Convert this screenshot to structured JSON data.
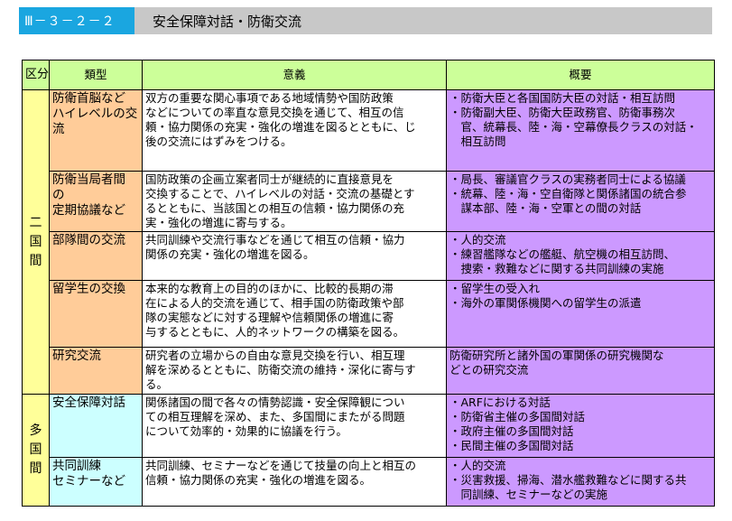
{
  "title": {
    "code": "Ⅲ－３－２－２",
    "text": "安全保障対話・防衛交流"
  },
  "table": {
    "headers": {
      "kubun": "区分",
      "ruikei": "類型",
      "igi": "意義",
      "gaiyo": "概要"
    },
    "groups": [
      {
        "kubun": "二国間",
        "rows": [
          {
            "ruikei": [
              "防衛首脳など",
              "ハイレベルの交",
              "流"
            ],
            "igi": [
              "双方の重要な関心事項である地域情勢や国防政策",
              "などについての率直な意見交換を通じて、相互の信",
              "頼・協力関係の充実・強化の増進を図るとともに、じ",
              "後の交流にはずみをつける。"
            ],
            "gaiyo": [
              "・防衛大臣と各国国防大臣の対話・相互訪問",
              "・防衛副大臣、防衛大臣政務官、防衛事務次",
              "　官、統幕長、陸・海・空幕僚長クラスの対話・",
              "　相互訪問"
            ]
          },
          {
            "ruikei": [
              "防衛当局者間",
              "の",
              "定期協議など"
            ],
            "igi": [
              "国防政策の企画立案者同士が継続的に直接意見を",
              "交換することで、ハイレベルの対話・交流の基礎とす",
              "るとともに、当該国との相互の信頼・協力関係の充",
              "実・強化の増進に寄与する。"
            ],
            "gaiyo": [
              "・局長、審議官クラスの実務者同士による協議",
              "・統幕、陸・海・空自衛隊と関係諸国の統合参",
              "　謀本部、陸・海・空軍との間の対話"
            ]
          },
          {
            "ruikei": [
              "部隊間の交流"
            ],
            "igi": [
              "共同訓練や交流行事などを通じて相互の信頼・協力",
              "関係の充実・強化の増進を図る。"
            ],
            "gaiyo": [
              "・人的交流",
              "・練習艦隊などの艦艇、航空機の相互訪問、",
              "　捜索・救難などに関する共同訓練の実施"
            ]
          },
          {
            "ruikei": [
              "留学生の交換"
            ],
            "igi": [
              "本来的な教育上の目的のほかに、比較的長期の滞",
              "在による人的交流を通じて、相手国の防衛政策や部",
              "隊の実態などに対する理解や信頼関係の増進に寄",
              "与するとともに、人的ネットワークの構築を図る。"
            ],
            "gaiyo": [
              "・留学生の受入れ",
              "・海外の軍関係機関への留学生の派遣"
            ]
          },
          {
            "ruikei": [
              "研究交流"
            ],
            "igi": [
              "研究者の立場からの自由な意見交換を行い、相互理",
              "解を深めるとともに、防衛交流の維持・深化に寄与す",
              "る。"
            ],
            "gaiyo": [
              "防衛研究所と諸外国の軍関係の研究機関な",
              "どとの研究交流"
            ]
          }
        ]
      },
      {
        "kubun": "多国間",
        "rows": [
          {
            "ruikei": [
              "安全保障対話"
            ],
            "igi": [
              "関係諸国の間で各々の情勢認識・安全保障観につい",
              "ての相互理解を深め、また、多国間にまたがる問題",
              "について効率的・効果的に協議を行う。"
            ],
            "gaiyo": [
              "・ARFにおける対話",
              "・防衛省主催の多国間対話",
              "・政府主催の多国間対話",
              "・民間主催の多国間対話"
            ]
          },
          {
            "ruikei": [
              "共同訓練",
              "セミナーなど"
            ],
            "igi": [
              "共同訓練、セミナーなどを通じて技量の向上と相互の",
              "信頼・協力関係の充実・強化の増進を図る。"
            ],
            "gaiyo": [
              "・人的交流",
              "・災害救援、掃海、潜水艦救難などに関する共",
              "　同訓練、セミナーなどの実施"
            ]
          }
        ]
      }
    ]
  }
}
